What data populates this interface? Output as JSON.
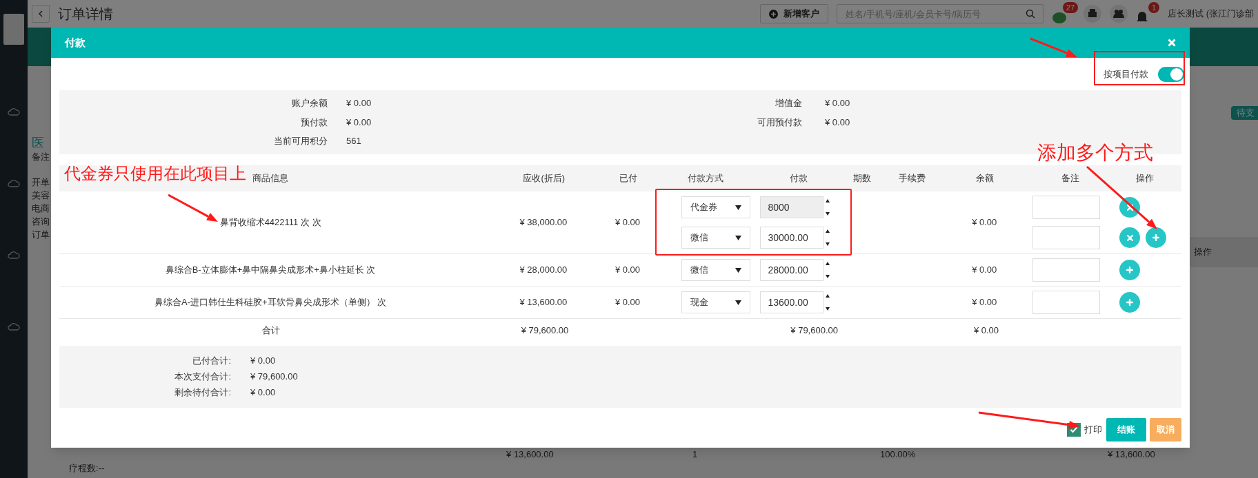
{
  "page": {
    "title": "订单详情",
    "new_customer": "新增客户",
    "search_placeholder": "姓名/手机号/座机/会员卡号/病历号",
    "message_badge": "27",
    "notice_badge": "1",
    "user": "店长测试 (张江门诊部"
  },
  "side_texts": [
    "医",
    "备注",
    "开单",
    "美容",
    "电商",
    "咨询",
    "订单"
  ],
  "right_texts": {
    "status": "待支",
    "column": "操作"
  },
  "bottom_row": {
    "course": "疗程数:--",
    "due": "¥ 13,600.00",
    "quantity": "1",
    "ratio": "100.00%",
    "amount": "¥ 13,600.00"
  },
  "dialog": {
    "title": "付款",
    "pay_by_item": {
      "label": "按项目付款",
      "on": true
    },
    "account_left": [
      {
        "label": "账户余额",
        "value": "¥ 0.00"
      },
      {
        "label": "预付款",
        "value": "¥ 0.00"
      },
      {
        "label": "当前可用积分",
        "value": "561"
      }
    ],
    "account_right": [
      {
        "label": "增值金",
        "value": "¥ 0.00"
      },
      {
        "label": "可用预付款",
        "value": "¥ 0.00"
      }
    ],
    "table": {
      "columns": [
        "商品信息",
        "应收(折后)",
        "已付",
        "付款方式",
        "付款",
        "期数",
        "手续费",
        "余额",
        "备注",
        "操作"
      ],
      "rows": [
        {
          "name": "鼻背收缩术4422111 次 次",
          "due": "¥ 38,000.00",
          "paid": "¥ 0.00",
          "balance": "¥ 0.00",
          "payments": [
            {
              "method": "代金券",
              "amount": "8000",
              "readonly": true,
              "removable": true,
              "addable": false
            },
            {
              "method": "微信",
              "amount": "30000.00",
              "readonly": false,
              "removable": true,
              "addable": true
            }
          ]
        },
        {
          "name": "鼻综合B-立体膨体+鼻中隔鼻尖成形术+鼻小柱延长 次",
          "due": "¥ 28,000.00",
          "paid": "¥ 0.00",
          "balance": "¥ 0.00",
          "payments": [
            {
              "method": "微信",
              "amount": "28000.00",
              "readonly": false,
              "removable": false,
              "addable": true
            }
          ]
        },
        {
          "name": "鼻综合A-进口韩仕生科硅胶+耳软骨鼻尖成形术（单侧） 次",
          "due": "¥ 13,600.00",
          "paid": "¥ 0.00",
          "balance": "¥ 0.00",
          "payments": [
            {
              "method": "现金",
              "amount": "13600.00",
              "readonly": false,
              "removable": false,
              "addable": true
            }
          ]
        }
      ],
      "total": {
        "label": "合计",
        "due": "¥ 79,600.00",
        "pay": "¥ 79,600.00",
        "balance": "¥ 0.00"
      }
    },
    "summary": [
      {
        "label": "已付合计:",
        "value": "¥ 0.00"
      },
      {
        "label": "本次支付合计:",
        "value": "¥ 79,600.00"
      },
      {
        "label": "剩余待付合计:",
        "value": "¥ 0.00"
      }
    ],
    "print": {
      "label": "打印",
      "checked": true
    },
    "buttons": {
      "confirm": "结账",
      "cancel": "取消"
    }
  },
  "annotations": [
    {
      "text": "代金券只使用在此项目上"
    },
    {
      "text": "添加多个方式"
    }
  ]
}
